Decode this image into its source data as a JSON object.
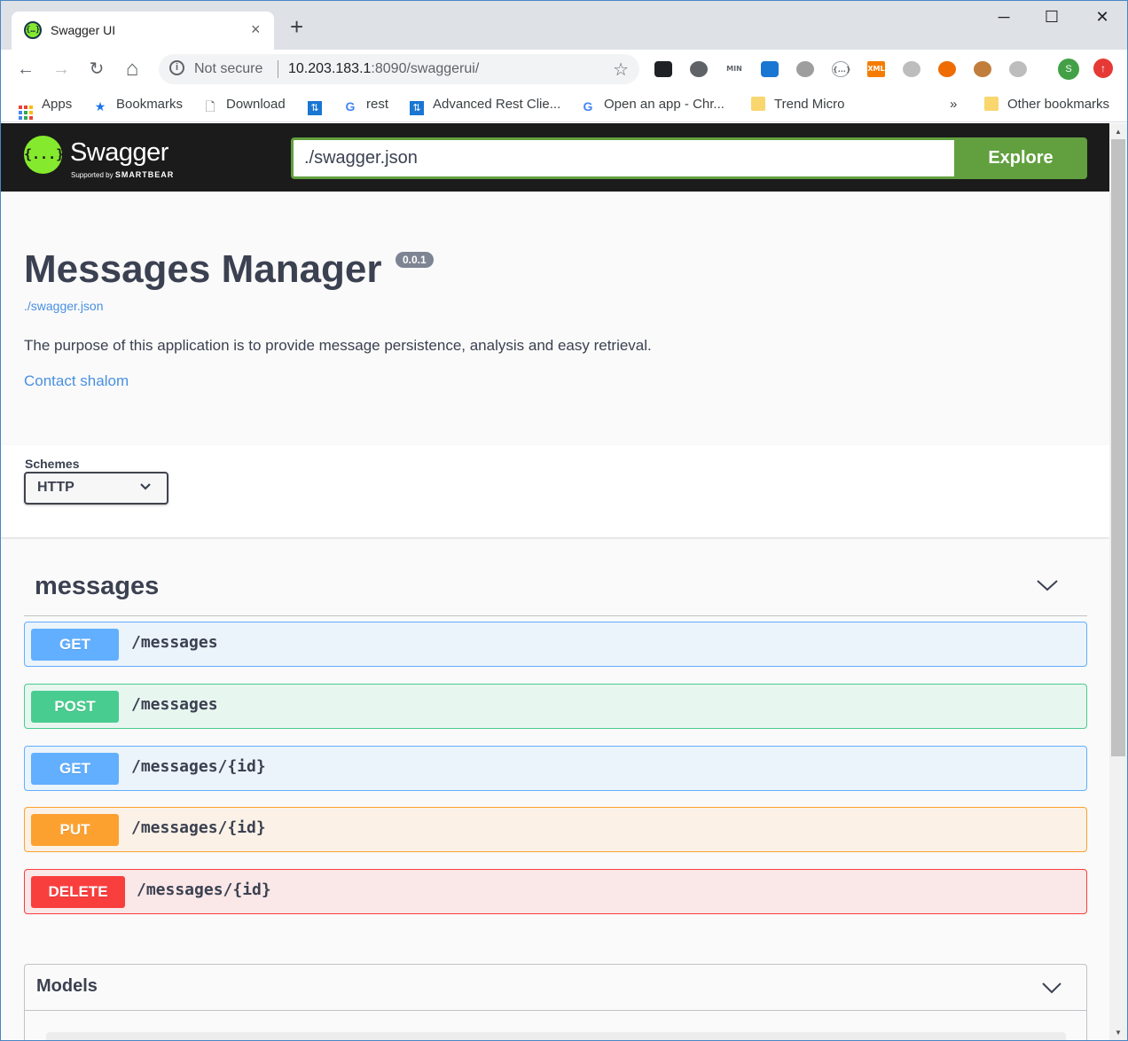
{
  "browser": {
    "tab_title": "Swagger UI",
    "tab_close": "×",
    "new_tab": "+",
    "window_controls": {
      "minimize": "─",
      "maximize": "☐",
      "close": "✕"
    },
    "nav": {
      "back": "←",
      "forward": "→",
      "reload": "↻",
      "home": "⌂"
    },
    "omnibox": {
      "security_icon": "i",
      "security_text": "Not secure",
      "host": "10.203.183.1",
      "rest": ":8090/swaggerui/",
      "star": "☆"
    },
    "extensions": [
      {
        "icon": "incognito-spy-icon",
        "label": "",
        "color": "#202124"
      },
      {
        "icon": "sync-icon",
        "label": "",
        "color": "#5f6368"
      },
      {
        "icon": "min-icon",
        "label": "MIN",
        "color": "#ffffff"
      },
      {
        "icon": "bluescreen-icon",
        "label": "",
        "color": "#1976d2"
      },
      {
        "icon": "speech-bubble-icon",
        "label": "",
        "color": "#9e9e9e"
      },
      {
        "icon": "json-braces-icon",
        "label": "{...}",
        "color": "#ffffff"
      },
      {
        "icon": "xml-icon",
        "label": "XML",
        "color": "#f57c00"
      },
      {
        "icon": "circle-grey-icon",
        "label": "",
        "color": "#bdbdbd"
      },
      {
        "icon": "lifebuoy-icon",
        "label": "",
        "color": "#ef6c00"
      },
      {
        "icon": "cookie-icon",
        "label": "",
        "color": "#c17d3c"
      },
      {
        "icon": "cast-icon",
        "label": "",
        "color": "#bdbdbd"
      }
    ],
    "profile_initial": "S",
    "update_arrow": "↑",
    "bookmarks": [
      {
        "icon": "apps-grid-icon",
        "label": "Apps"
      },
      {
        "icon": "star-icon",
        "label": "Bookmarks"
      },
      {
        "icon": "page-icon",
        "label": "Download"
      },
      {
        "icon": "arc-icon",
        "label": ""
      },
      {
        "icon": "google-icon",
        "label": "rest"
      },
      {
        "icon": "arc-icon",
        "label": "Advanced Rest Clie..."
      },
      {
        "icon": "google-icon",
        "label": "Open an app - Chr..."
      },
      {
        "icon": "folder-icon",
        "label": "Trend Micro"
      }
    ],
    "bookmarks_overflow": "»",
    "other_bookmarks": "Other bookmarks"
  },
  "swagger": {
    "logo": {
      "braces": "{...}",
      "name": "Swagger",
      "sub_prefix": "Supported by ",
      "sub_brand": "SMARTBEAR"
    },
    "spec_url_value": "./swagger.json",
    "explore_label": "Explore",
    "info": {
      "title": "Messages Manager",
      "version": "0.0.1",
      "spec_link": "./swagger.json",
      "description": "The purpose of this application is to provide message persistence, analysis and easy retrieval.",
      "contact": "Contact shalom"
    },
    "schemes": {
      "label": "Schemes",
      "selected": "HTTP"
    },
    "tag": {
      "name": "messages"
    },
    "operations": [
      {
        "method": "GET",
        "path": "/messages",
        "color": "#61affe",
        "bg": "#ebf3fb",
        "border": "#61affe"
      },
      {
        "method": "POST",
        "path": "/messages",
        "color": "#49cc90",
        "bg": "#e8f6f0",
        "border": "#49cc90"
      },
      {
        "method": "GET",
        "path": "/messages/{id}",
        "color": "#61affe",
        "bg": "#ebf3fb",
        "border": "#61affe"
      },
      {
        "method": "PUT",
        "path": "/messages/{id}",
        "color": "#fca130",
        "bg": "#fbf1e6",
        "border": "#fca130"
      },
      {
        "method": "DELETE",
        "path": "/messages/{id}",
        "color": "#f93e3e",
        "bg": "#fae7e7",
        "border": "#f93e3e"
      }
    ],
    "models": {
      "title": "Models"
    }
  }
}
